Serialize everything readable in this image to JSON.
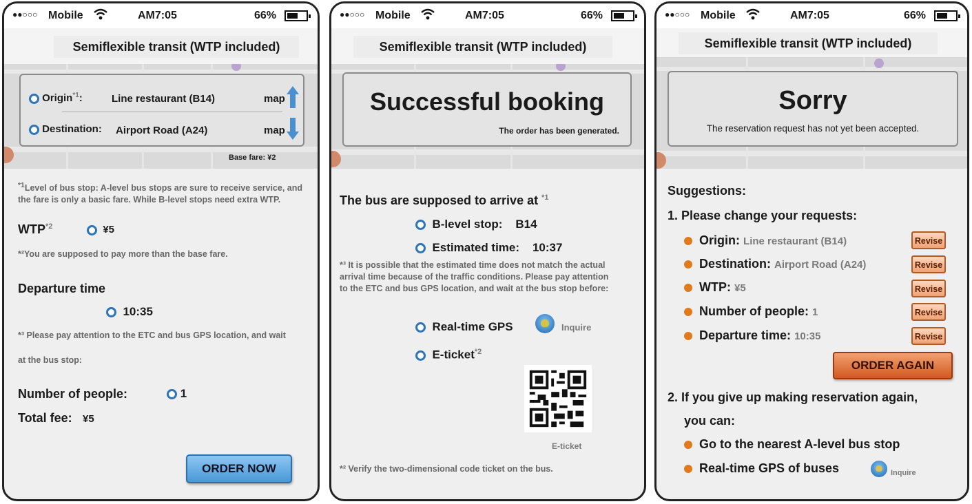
{
  "status": {
    "carrier": "Mobile",
    "time": "AM7:05",
    "battery": "66%"
  },
  "header": {
    "title": "Semiflexible transit (WTP included)"
  },
  "screen1": {
    "origin_label": "Origin",
    "origin_sup": "*1",
    "origin_colon": ":",
    "origin_value": "Line restaurant (B14)",
    "map_label": "map",
    "dest_label": "Destination:",
    "dest_value": "Airport Road (A24)",
    "base_fare": "Base fare: ¥2",
    "note1_sup": "*1",
    "note1_text": "Level of bus stop: A-level bus stops are sure to receive service, and the fare is only a basic fare. While B-level stops need extra WTP.",
    "wtp_label": "WTP",
    "wtp_sup": "*2",
    "wtp_value": "¥5",
    "note2_text": "*²You are supposed to pay more than the base fare.",
    "departure_label": "Departure time",
    "departure_value": "10:35",
    "note3_line1": "*³ Please pay attention to the ETC and bus GPS location, and wait",
    "note3_line2": "at the bus stop:",
    "people_label": "Number of people:",
    "people_value": "1",
    "total_label": "Total fee:",
    "total_value": "¥5",
    "order_button": "ORDER NOW"
  },
  "screen2": {
    "headline": "Successful booking",
    "subline": "The order has been generated.",
    "arrive_text": "The bus are supposed to arrive at",
    "arrive_sup": "*1",
    "stop_label": "B-level stop:",
    "stop_value": "B14",
    "est_label": "Estimated time:",
    "est_value": "10:37",
    "note3_text": "*³ It is possible that the estimated time does not match the actual arrival time because of the traffic conditions. Please pay attention to the ETC and bus GPS location, and wait at the bus stop before:",
    "gps_label": "Real-time GPS",
    "inquire_label": "Inquire",
    "eticket_label": "E-ticket",
    "eticket_sup": "*2",
    "qr_caption": "E-ticket",
    "note2_text": "*² Verify the two-dimensional code ticket on the bus."
  },
  "screen3": {
    "headline": "Sorry",
    "subline": "The reservation request has not yet been accepted.",
    "suggestions": "Suggestions:",
    "item1": "1. Please change your requests:",
    "requests": [
      {
        "label": "Origin:",
        "value": "Line restaurant (B14)",
        "button": "Revise"
      },
      {
        "label": "Destination:",
        "value": "Airport Road (A24)",
        "button": "Revise"
      },
      {
        "label": "WTP:",
        "value": "¥5",
        "button": "Revise"
      },
      {
        "label": "Number of people:",
        "value": "1",
        "button": "Revise"
      },
      {
        "label": "Departure time:",
        "value": "10:35",
        "button": "Revise"
      }
    ],
    "order_again": "ORDER AGAIN",
    "item2_line1": "2. If you give up making reservation again,",
    "item2_line2": "you can:",
    "option1": "Go to the nearest A-level bus stop",
    "option2": "Real-time GPS of buses",
    "inquire_label": "Inquire"
  },
  "colors": {
    "accent_blue": "#2d74b8",
    "button_blue": "#4a98d8",
    "button_orange": "#d25a20",
    "bullet_orange": "#e07a1c"
  }
}
